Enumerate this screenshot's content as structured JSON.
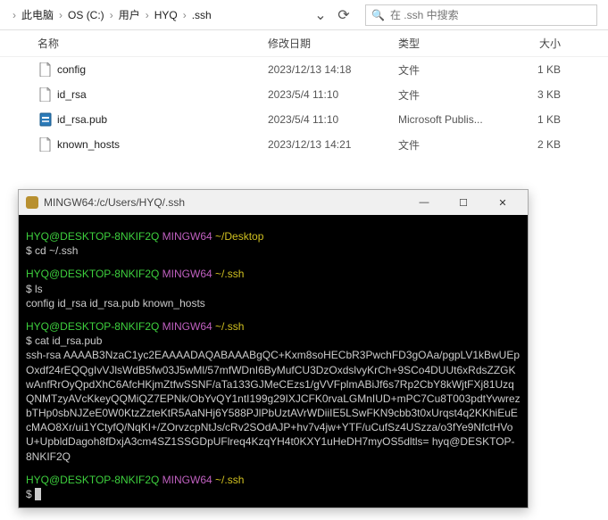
{
  "breadcrumb": [
    "此电脑",
    "OS (C:)",
    "用户",
    "HYQ",
    ".ssh"
  ],
  "search": {
    "placeholder": "在 .ssh 中搜索"
  },
  "columns": {
    "name": "名称",
    "date": "修改日期",
    "type": "类型",
    "size": "大小"
  },
  "files": [
    {
      "icon": "file",
      "name": "config",
      "date": "2023/12/13 14:18",
      "type": "文件",
      "size": "1 KB"
    },
    {
      "icon": "file",
      "name": "id_rsa",
      "date": "2023/5/4 11:10",
      "type": "文件",
      "size": "3 KB"
    },
    {
      "icon": "pub",
      "name": "id_rsa.pub",
      "date": "2023/5/4 11:10",
      "type": "Microsoft Publis...",
      "size": "1 KB"
    },
    {
      "icon": "file",
      "name": "known_hosts",
      "date": "2023/12/13 14:21",
      "type": "文件",
      "size": "2 KB"
    }
  ],
  "terminal": {
    "title": "MINGW64:/c/Users/HYQ/.ssh",
    "prompts": [
      {
        "user": "HYQ@DESKTOP-8NKIF2Q",
        "env": "MINGW64",
        "path": "~/Desktop",
        "cmd": "cd ~/.ssh",
        "out": ""
      },
      {
        "user": "HYQ@DESKTOP-8NKIF2Q",
        "env": "MINGW64",
        "path": "~/.ssh",
        "cmd": "ls",
        "out": "config  id_rsa  id_rsa.pub  known_hosts"
      },
      {
        "user": "HYQ@DESKTOP-8NKIF2Q",
        "env": "MINGW64",
        "path": "~/.ssh",
        "cmd": "cat id_rsa.pub",
        "out": "ssh-rsa AAAAB3NzaC1yc2EAAAADAQABAAABgQC+Kxm8soHECbR3PwchFD3gOAa/pgpLV1kBwUEpOxdf24rEQQgIvVJlsWdB5fw03J5wMl/57mfWDnI6ByMufCU3DzOxdslvyKrCh+9SCo4DUUt6xRdsZZGKwAnfRrOyQpdXhC6AfcHKjmZtfwSSNF/aTa133GJMeCEzs1/gVVFplmABiJf6s7Rp2CbY8kWjtFXj81UzqQNMTzyAVcKkeyQQMiQZ7EPNk/ObYvQY1ntI199g29IXJCFK0rvaLGMnIUD+mPC7Cu8T003pdtYvwrezbTHp0sbNJZeE0W0KtzZzteKtR5AaNHj6Y588PJlPbUztAVrWDiiIE5LSwFKN9cbb3t0xUrqst4q2KKhiEuEcMAO8Xr/ui1YCtyfQ/NqKI+/ZOrvzcpNtJs/cRv2SOdAJP+hv7v4jw+YTF/uCufSz4USzza/o3fYe9NfctHVoU+UpbldDagoh8fDxjA3cm4SZ1SSGDpUFlreq4KzqYH4t0KXY1uHeDH7myOS5dltls= hyq@DESKTOP-8NKIF2Q"
      },
      {
        "user": "HYQ@DESKTOP-8NKIF2Q",
        "env": "MINGW64",
        "path": "~/.ssh",
        "cmd": "",
        "out": ""
      }
    ]
  }
}
